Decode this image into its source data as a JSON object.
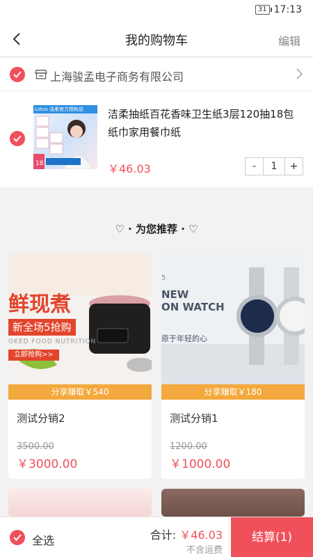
{
  "status": {
    "battery": "31",
    "time": "17:13"
  },
  "nav": {
    "title": "我的购物车",
    "edit": "编辑"
  },
  "cart": {
    "shop_name": "上海骏孟电子商务有限公司",
    "product": {
      "title": "洁柔抽纸百花香味卫生纸3层120抽18包纸巾家用餐巾纸",
      "price": "￥46.03",
      "qty": "1",
      "minus": "-",
      "plus": "+",
      "image_text": "Lotus 洁柔官方授权店"
    }
  },
  "recommend": {
    "title": "♡ · 为您推荐 · ♡"
  },
  "items": [
    {
      "name": "测试分销2",
      "share": "分享赚取￥540",
      "old_price": "3500.00",
      "price": "￥3000.00",
      "banner_line1": "鲜现煮",
      "banner_line2": "新全场5抢购",
      "banner_line3": "OKED FOOD NUTRITION",
      "banner_line4": "立即抢购>>"
    },
    {
      "name": "测试分销1",
      "share": "分享赚取￥180",
      "old_price": "1200.00",
      "price": "￥1000.00",
      "banner_line1": "NEW",
      "banner_line2": "ON WATCH",
      "banner_line3": "原于年轻的心",
      "banner_line4": "5"
    }
  ],
  "bottom": {
    "select_all": "全选",
    "total_label": "合计:",
    "total": "￥46.03",
    "no_shipping": "不含运费",
    "checkout": "结算(1)"
  },
  "colors": {
    "accent": "#f0505a",
    "share": "#f3a93d"
  }
}
